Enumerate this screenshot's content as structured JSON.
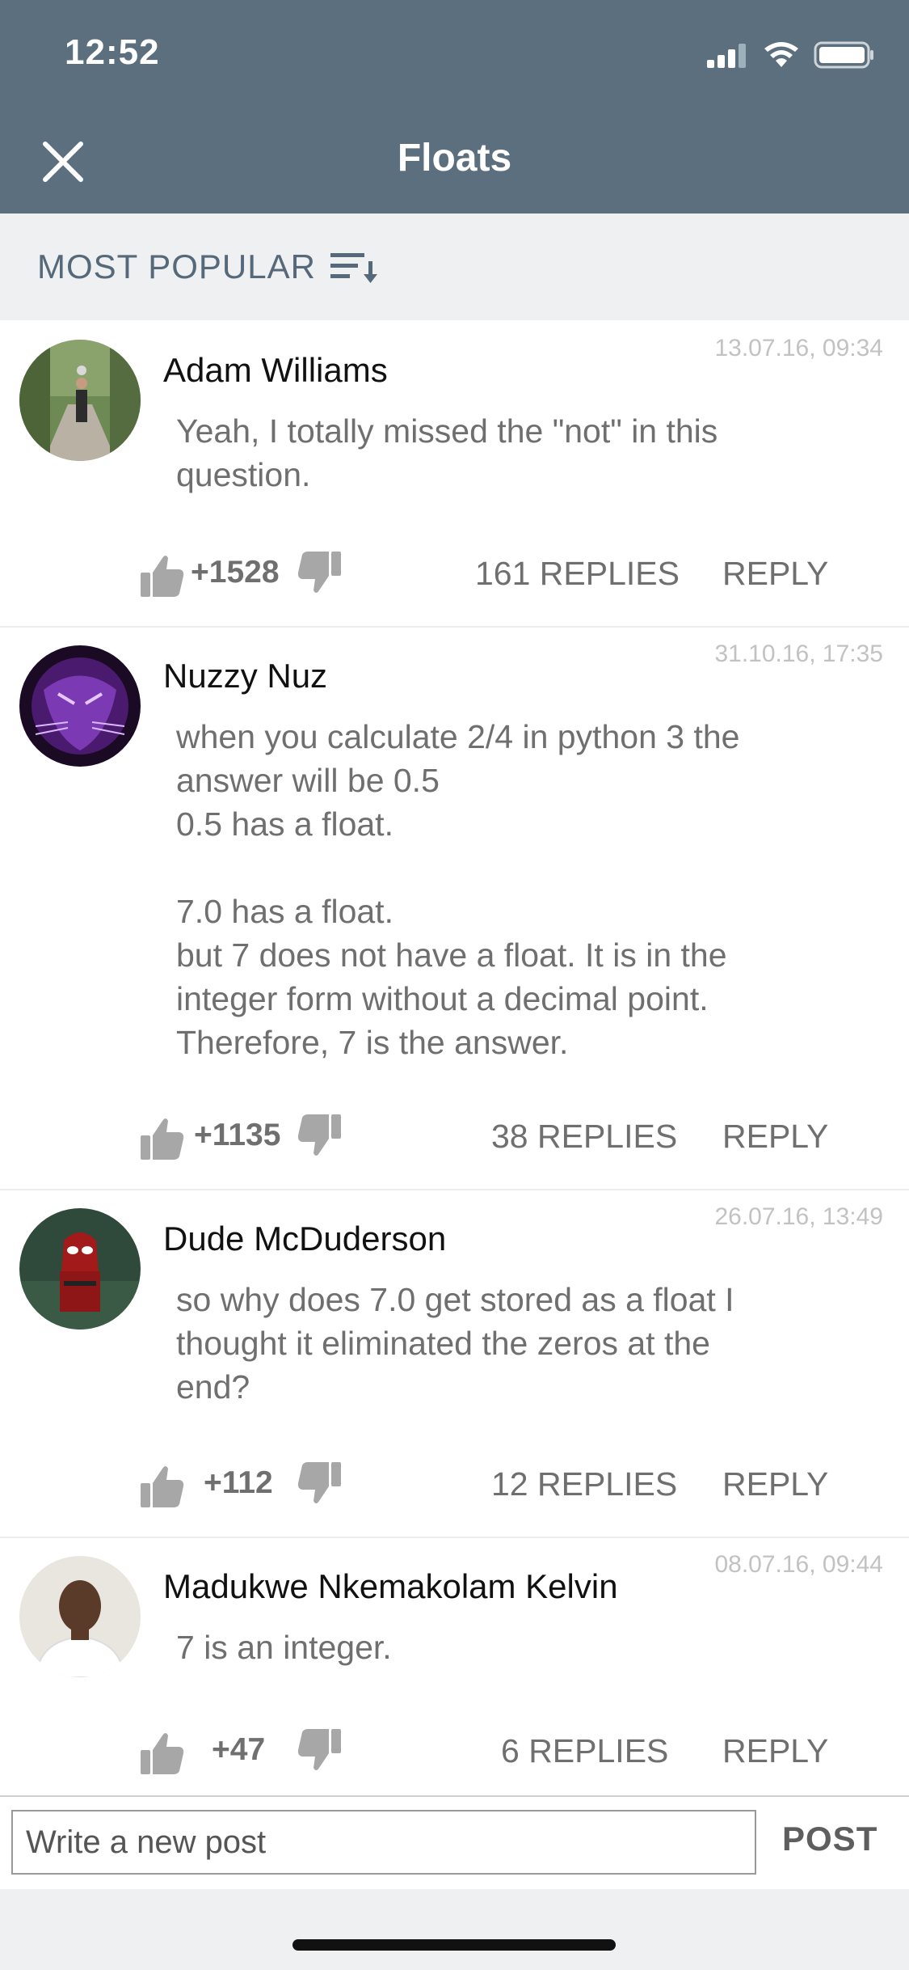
{
  "status": {
    "time": "12:52"
  },
  "header": {
    "title": "Floats"
  },
  "sort": {
    "label": "MOST POPULAR"
  },
  "comments": [
    {
      "author": "Adam Williams",
      "date": "13.07.16, 09:34",
      "body": "Yeah, I totally missed the \"not\" in this\nquestion.",
      "votes": "+1528",
      "replies": "161 REPLIES",
      "reply": "REPLY"
    },
    {
      "author": "Nuzzy Nuz",
      "date": "31.10.16, 17:35",
      "body": "when you calculate 2/4 in python 3 the\nanswer will be 0.5\n0.5 has a float.\n\n7.0 has a float.\nbut 7 does not have a float. It is in the\ninteger form without a decimal point.\nTherefore, 7 is the answer.",
      "votes": "+1135",
      "replies": "38 REPLIES",
      "reply": "REPLY"
    },
    {
      "author": "Dude McDuderson",
      "date": "26.07.16, 13:49",
      "body": "so why does 7.0 get stored as a float I\nthought it eliminated the zeros at the\nend?",
      "votes": "+112",
      "replies": "12 REPLIES",
      "reply": "REPLY"
    },
    {
      "author": "Madukwe Nkemakolam Kelvin",
      "date": "08.07.16, 09:44",
      "body": "7 is an integer.",
      "votes": "+47",
      "replies": "6 REPLIES",
      "reply": "REPLY"
    }
  ],
  "composer": {
    "placeholder": "Write a new post",
    "post_label": "POST"
  },
  "colors": {
    "header": "#5c6f7e",
    "sortbar": "#eff0f1",
    "sort_text": "#56697a"
  },
  "icons": [
    "close-icon",
    "sort-icon",
    "thumbs-up-icon",
    "thumbs-down-icon",
    "signal-icon",
    "wifi-icon",
    "battery-icon"
  ]
}
